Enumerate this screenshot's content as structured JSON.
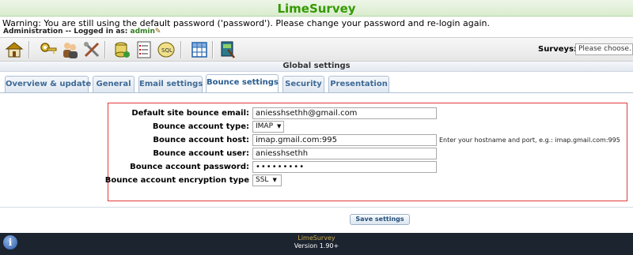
{
  "header": {
    "app_title": "LimeSurvey"
  },
  "warning": {
    "text": "Warning: You are still using the default password ('password'). Please change your password and re-login again."
  },
  "admin": {
    "prefix": "Administration -- Logged in as:",
    "username": "admin"
  },
  "toolbar": {
    "icons": [
      "home-icon",
      "key-icon",
      "users-icon",
      "tools-icon",
      "database-icon",
      "checklist-icon",
      "sql-backup-icon",
      "grid-icon",
      "template-editor-icon"
    ],
    "surveys_label": "Surveys:",
    "surveys_select": "Please choose..."
  },
  "page": {
    "title": "Global settings"
  },
  "tabs": [
    {
      "label": "Overview & update",
      "active": false
    },
    {
      "label": "General",
      "active": false
    },
    {
      "label": "Email settings",
      "active": false
    },
    {
      "label": "Bounce settings",
      "active": true
    },
    {
      "label": "Security",
      "active": false
    },
    {
      "label": "Presentation",
      "active": false
    }
  ],
  "form": {
    "site_bounce_email": {
      "label": "Default site bounce email:",
      "value": "aniesshsethh@gmail.com"
    },
    "account_type": {
      "label": "Bounce account type:",
      "value": "IMAP"
    },
    "account_host": {
      "label": "Bounce account host:",
      "value": "imap.gmail.com:995",
      "hint": "Enter your hostname and port, e.g.: imap.gmail.com:995"
    },
    "account_user": {
      "label": "Bounce account user:",
      "value": "aniesshsethh"
    },
    "account_password": {
      "label": "Bounce account password:",
      "value": "•••••••••"
    },
    "encryption_type": {
      "label": "Bounce account encryption type",
      "value": "SSL"
    }
  },
  "actions": {
    "save_label": "Save settings"
  },
  "footer": {
    "line1": "LimeSurvey",
    "line2": "Version 1.90+",
    "info_icon": "info-icon"
  },
  "colors": {
    "brand_green": "#339900",
    "highlight_border": "#e23b3b",
    "footer_bg": "#1c2430",
    "tab_text": "#3e6a97"
  }
}
